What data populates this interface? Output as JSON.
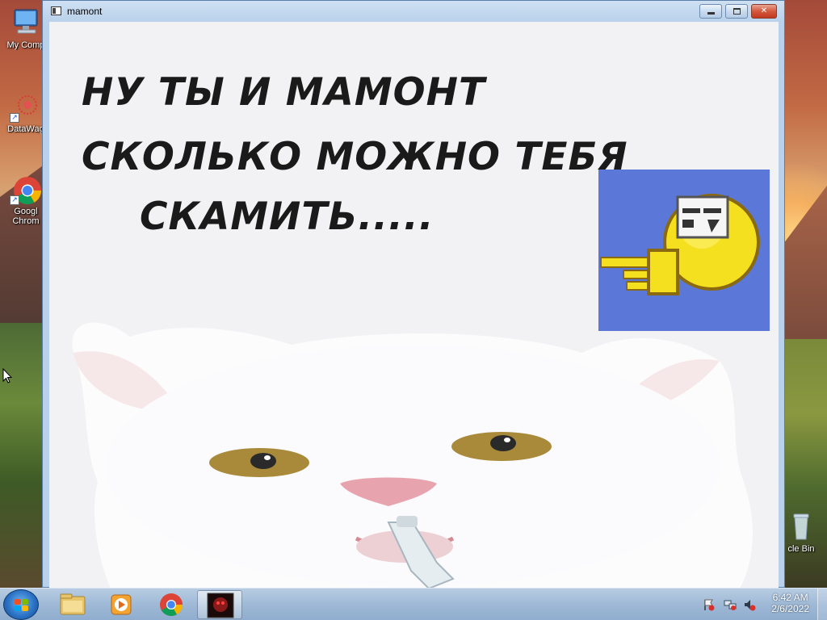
{
  "desktop": {
    "icons": [
      {
        "label": "My Comp",
        "icon": "computer-icon"
      },
      {
        "label": "DataWag",
        "icon": "datawag-icon"
      },
      {
        "label": "Googl",
        "label2": "Chrom",
        "icon": "chrome-icon"
      },
      {
        "label": "cle Bin",
        "icon": "recycle-bin-icon"
      }
    ]
  },
  "window": {
    "title": "mamont",
    "controls": {
      "minimize": "minimize",
      "maximize": "maximize",
      "close": "✕"
    },
    "meme": {
      "line1": "НУ ТЫ И МАМОНТ",
      "line2": "СКОЛЬКО МОЖНО ТЕБЯ",
      "line3": "СКАМИТЬ.....",
      "emoji": "pointing-smiley-icon",
      "image": "white-cat-with-cigarette"
    }
  },
  "taskbar": {
    "start": "start-orb-icon",
    "apps": [
      "explorer-icon",
      "media-player-icon",
      "chrome-icon",
      "mamont-app-icon"
    ],
    "tray": [
      "action-center-flag-icon",
      "network-icon",
      "volume-muted-icon"
    ],
    "clock": {
      "time": "6:42 AM",
      "date": "2/6/2022"
    },
    "colors": {
      "taskbar": "#9fb9d6",
      "emoji_bg": "#5b77d8",
      "client_bg": "#f2f1f3"
    }
  }
}
